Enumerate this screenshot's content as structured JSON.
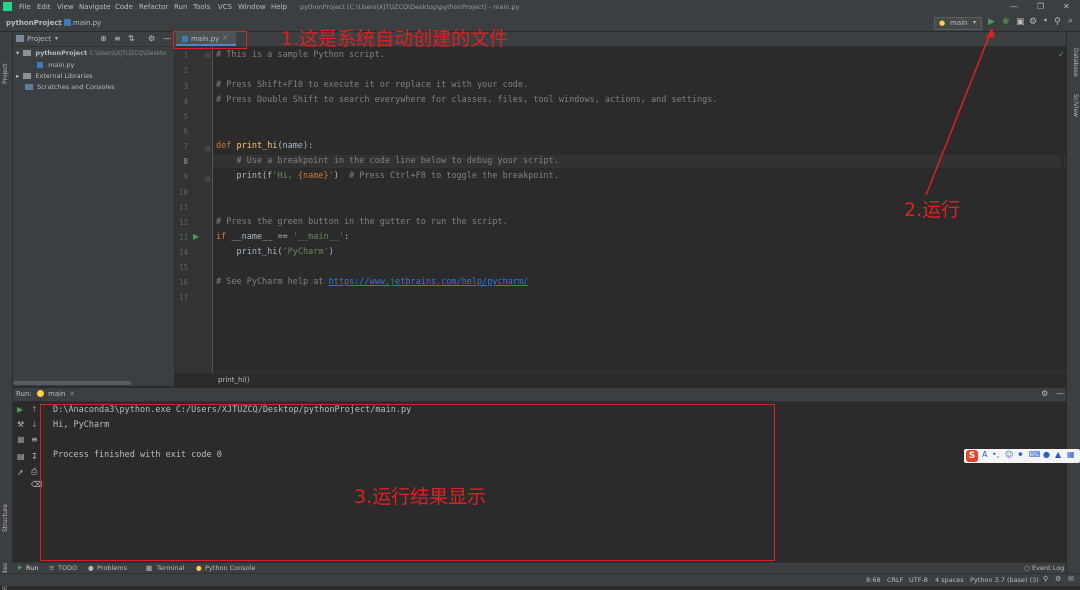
{
  "titlebar": {
    "menus": [
      "File",
      "Edit",
      "View",
      "Navigate",
      "Code",
      "Refactor",
      "Run",
      "Tools",
      "VCS",
      "Window",
      "Help"
    ],
    "window_title": "pythonProject [C:\\Users\\XJTUZCQ\\Desktop\\pythonProject] - main.py"
  },
  "navbar": {
    "project": "pythonProject",
    "file": "main.py",
    "run_config": "main"
  },
  "left_strip": {
    "project_tab": "Project",
    "structure_tab": "Structure",
    "favorites_tab": "Favorites"
  },
  "right_strip": {
    "database_tab": "Database",
    "sciview_tab": "SciView"
  },
  "project_panel": {
    "header": "Project",
    "tree": {
      "root_name": "pythonProject",
      "root_path": "C:\\Users\\XJTUZCQ\\Deskto",
      "main_file": "main.py",
      "ext_libs": "External Libraries",
      "scratches": "Scratches and Consoles"
    }
  },
  "editor": {
    "tab_label": "main.py",
    "line_numbers": [
      "1",
      "2",
      "3",
      "4",
      "5",
      "6",
      "7",
      "8",
      "9",
      "10",
      "11",
      "12",
      "13",
      "14",
      "15",
      "16",
      "17"
    ],
    "code": {
      "l1": "# This is a sample Python script.",
      "l3": "# Press Shift+F10 to execute it or replace it with your code.",
      "l4": "# Press Double Shift to search everywhere for classes, files, tool windows, actions, and settings.",
      "l7_kw": "def",
      "l7_fn": "print_hi",
      "l7_rest": "(name):",
      "l8": "    # Use a breakpoint in the code line below to debug your script.",
      "l9_a": "    print(f",
      "l9_str1": "'Hi, ",
      "l9_brace": "{name}",
      "l9_str2": "'",
      "l9_b": ")  ",
      "l9_cm": "# Press Ctrl+F8 to toggle the breakpoint.",
      "l12": "# Press the green button in the gutter to run the script.",
      "l13_kw": "if",
      "l13_name": "__name__",
      "l13_eq": " == ",
      "l13_str": "'__main__'",
      "l13_colon": ":",
      "l14_a": "    print_hi(",
      "l14_str": "'PyCharm'",
      "l14_b": ")",
      "l16_cm": "# See PyCharm help at ",
      "l16_link": "https://www.jetbrains.com/help/pycharm/"
    },
    "breadcrumb": "print_hi()"
  },
  "run_panel": {
    "label": "Run:",
    "tab": "main",
    "output": [
      "D:\\Anaconda3\\python.exe C:/Users/XJTUZCQ/Desktop/pythonProject/main.py",
      "Hi, PyCharm",
      "",
      "Process finished with exit code 0"
    ]
  },
  "bottom_tabs": [
    "Run",
    "TODO",
    "Problems",
    "Terminal",
    "Python Console"
  ],
  "event_log": "Event Log",
  "status": {
    "position": "8:68",
    "line_sep": "CRLF",
    "encoding": "UTF-8",
    "indent": "4 spaces",
    "interpreter": "Python 3.7 (base) (3)"
  },
  "annotations": {
    "a1": "1.这是系统自动创建的文件",
    "a2": "2.运行",
    "a3": "3.运行结果显示"
  },
  "colors": {
    "annotation": "#e02020",
    "run_green": "#499c54",
    "keyword": "#cc7832"
  },
  "icons": [
    "run-icon",
    "debug-icon",
    "coverage-icon",
    "profile-icon",
    "search-icon",
    "settings-icon",
    "python-file-icon",
    "folder-icon",
    "rerun-icon",
    "stop-icon",
    "wrench-icon",
    "print-icon",
    "trash-icon",
    "pin-icon",
    "checkmark-icon"
  ]
}
